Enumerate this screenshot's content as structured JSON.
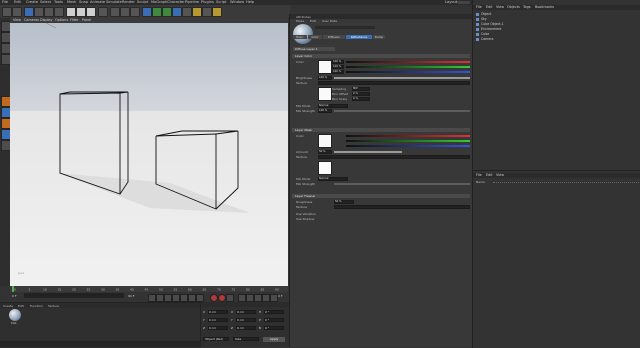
{
  "main_menu": [
    "File",
    "Edit",
    "Create",
    "Select",
    "Tools",
    "Mesh",
    "Snap",
    "Animate",
    "Simulate",
    "Render",
    "Sculpt",
    "MoGraph",
    "Character",
    "Pipeline",
    "Plugins",
    "Script",
    "Window",
    "Help"
  ],
  "layout_label": "Layout:",
  "viewport": {
    "menu": [
      "View",
      "Cameras",
      "Display",
      "Options",
      "Filter",
      "Panel"
    ],
    "axis_label": "y+x"
  },
  "timeline": {
    "ticks": [
      "0",
      "5",
      "10",
      "15",
      "20",
      "25",
      "30",
      "35",
      "40",
      "45",
      "50",
      "55",
      "60",
      "65",
      "70",
      "75",
      "80",
      "85",
      "90"
    ],
    "start_frame": "0 F",
    "end_frame": "90 F",
    "current_frame": "0 F"
  },
  "material_manager": {
    "menu": [
      "Create",
      "Edit",
      "Function",
      "Texture"
    ],
    "material_name": "Mat"
  },
  "coordinates": {
    "rows": [
      {
        "axis": "X",
        "pos": "0 cm",
        "size": "0 cm",
        "rot_label": "H",
        "rot": "0 °"
      },
      {
        "axis": "Y",
        "pos": "0 cm",
        "size": "0 cm",
        "rot_label": "P",
        "rot": "0 °"
      },
      {
        "axis": "Z",
        "pos": "0 cm",
        "size": "0 cm",
        "rot_label": "B",
        "rot": "0 °"
      }
    ],
    "mode_a": "Object (Rel)",
    "mode_b": "Size",
    "apply": "Apply"
  },
  "attributes": {
    "title": "Attributes",
    "menu": [
      "Mode",
      "Edit",
      "User Data"
    ],
    "tabs": [
      "Basic",
      "Color",
      "Diffusion",
      "Reflectance",
      "Bump"
    ],
    "active_tab": "Reflectance",
    "sub_tabs": [
      "Diffuse Layer",
      "Layer Fresnel"
    ],
    "layer_name": "Diffuse Layer 1",
    "sections": {
      "layer_color": "Layer Color",
      "layer_mask": "Layer Mask",
      "layer_fresnel": "Layer Fresnel"
    },
    "rows": {
      "color": "Color",
      "brightness": "Brightness",
      "texture": "Texture",
      "mix_mode": "Mix Mode",
      "mix_strength": "Mix Strength",
      "amount": "Amount",
      "roughness": "Roughness",
      "use_variation": "Use Variation",
      "use_shadow": "Use Shadow"
    },
    "values": {
      "r": "100 %",
      "g": "100 %",
      "b": "100 %",
      "brightness": "100 %",
      "mix_mode": "Normal",
      "mix_strength": "100 %",
      "amount": "50 %",
      "roughness": "50 %",
      "sampling": "MIP",
      "blur_offset": "0 %",
      "blur_scale": "0 %"
    },
    "mini_labels": [
      "Sampling",
      "Blur Offset",
      "Blur Scale"
    ]
  },
  "object_manager": {
    "menu": [
      "File",
      "Edit",
      "View",
      "Objects",
      "Tags",
      "Bookmarks"
    ],
    "objects": [
      "Object",
      "Sky",
      "Cube Object.1",
      "Environment",
      "Cube",
      "Camera"
    ]
  },
  "layers": {
    "menu": [
      "File",
      "Edit",
      "View"
    ],
    "header": "Name"
  },
  "colors": {
    "panel": "#383838",
    "accent_blue": "#3a6fb5",
    "record_red": "#b03a3a",
    "viewport_floor": "#ececec"
  }
}
